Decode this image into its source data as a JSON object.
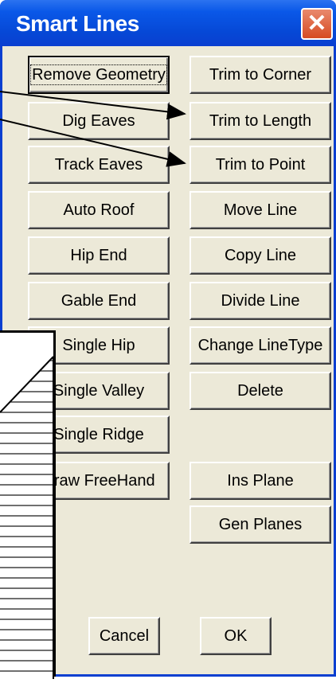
{
  "window": {
    "title": "Smart Lines",
    "close_glyph": "✕"
  },
  "left_buttons": [
    {
      "label": "Remove Geometry"
    },
    {
      "label": "Dig Eaves"
    },
    {
      "label": "Track Eaves"
    },
    {
      "label": "Auto Roof"
    },
    {
      "label": "Hip End"
    },
    {
      "label": "Gable End"
    },
    {
      "label": "Single Hip"
    },
    {
      "label": "Single Valley"
    },
    {
      "label": "Single Ridge"
    },
    {
      "label": "Draw FreeHand"
    }
  ],
  "right_buttons": [
    {
      "label": "Trim to Corner"
    },
    {
      "label": "Trim to Length"
    },
    {
      "label": "Trim to Point"
    },
    {
      "label": "Move Line"
    },
    {
      "label": "Copy Line"
    },
    {
      "label": "Divide Line"
    },
    {
      "label": "Change LineType"
    },
    {
      "label": "Delete"
    },
    {
      "label": "Ins Plane"
    },
    {
      "label": "Gen Planes"
    }
  ],
  "footer": {
    "cancel_label": "Cancel",
    "ok_label": "OK"
  },
  "colors": {
    "titlebar": "#0a58e8",
    "dialog_bg": "#ece9d8",
    "close": "#d64b22"
  }
}
